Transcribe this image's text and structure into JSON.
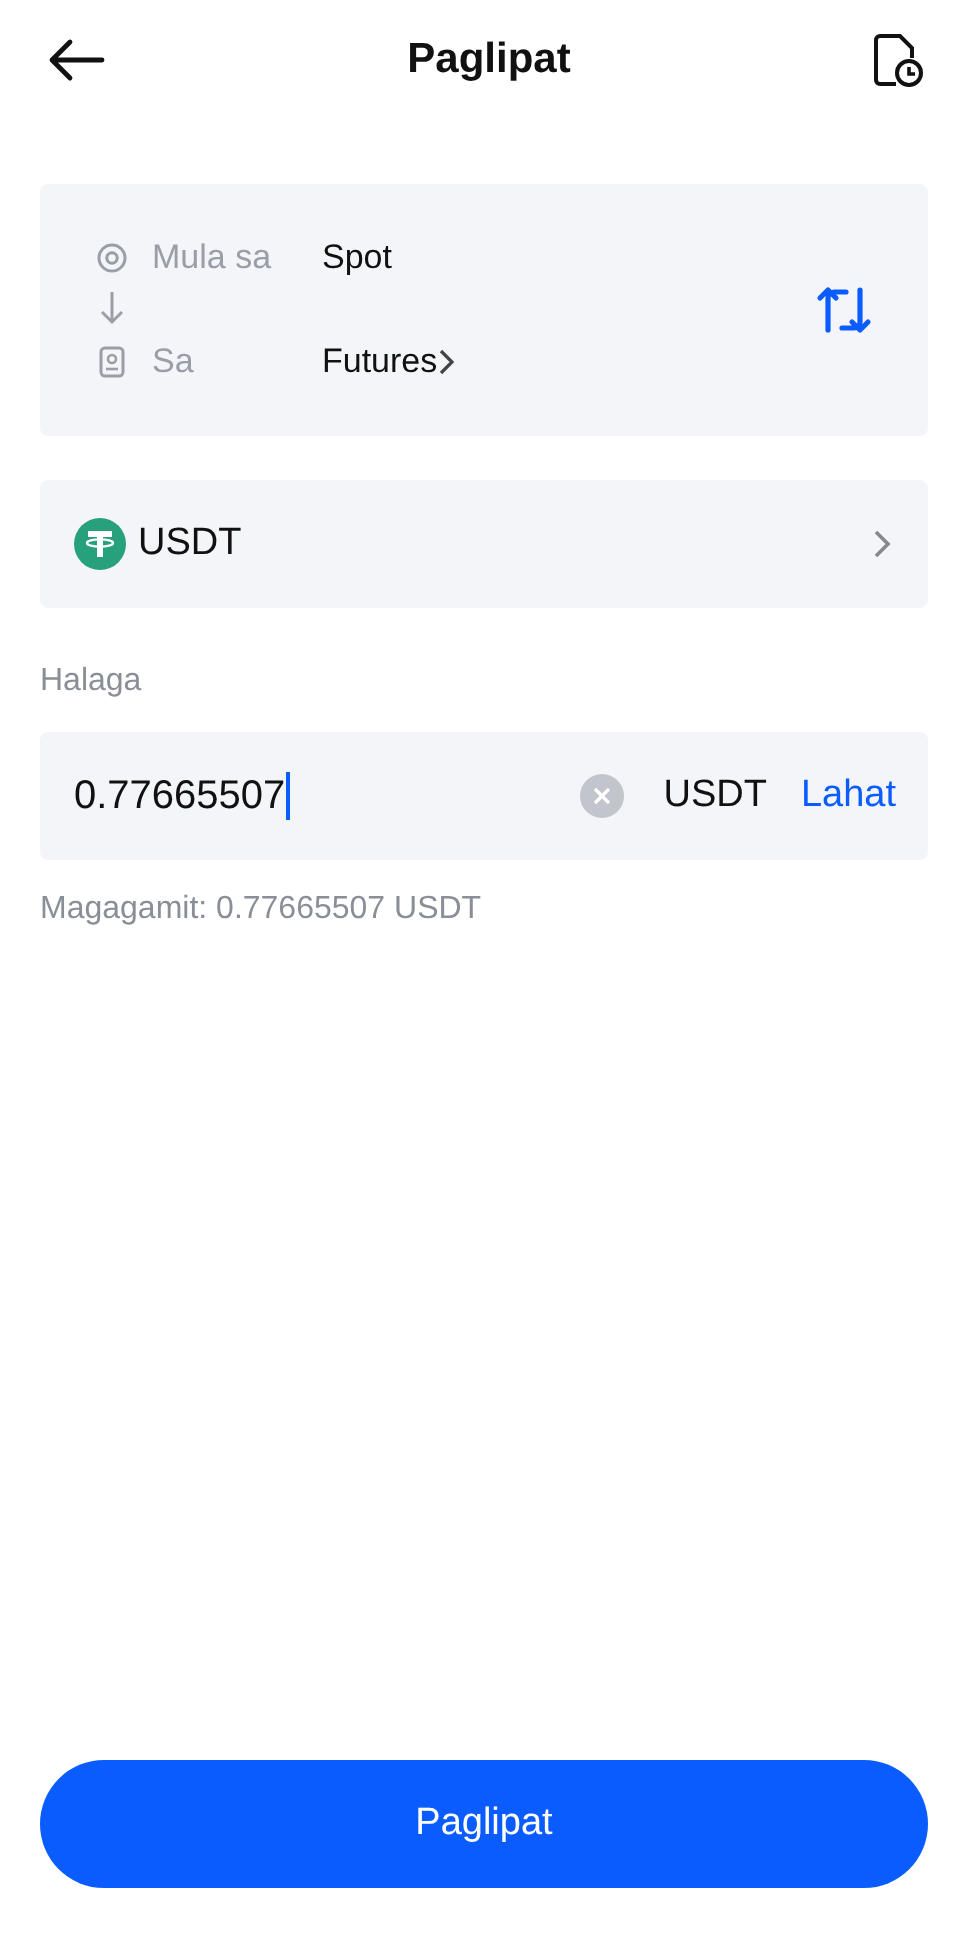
{
  "header": {
    "title": "Paglipat"
  },
  "transfer": {
    "from_label": "Mula sa",
    "from_value": "Spot",
    "to_label": "Sa",
    "to_value": "Futures"
  },
  "coin": {
    "name": "USDT"
  },
  "amount": {
    "label": "Halaga",
    "value": "0.77665507",
    "unit": "USDT",
    "max_link": "Lahat"
  },
  "available": "Magagamit: 0.77665507 USDT",
  "submit": "Paglipat"
}
